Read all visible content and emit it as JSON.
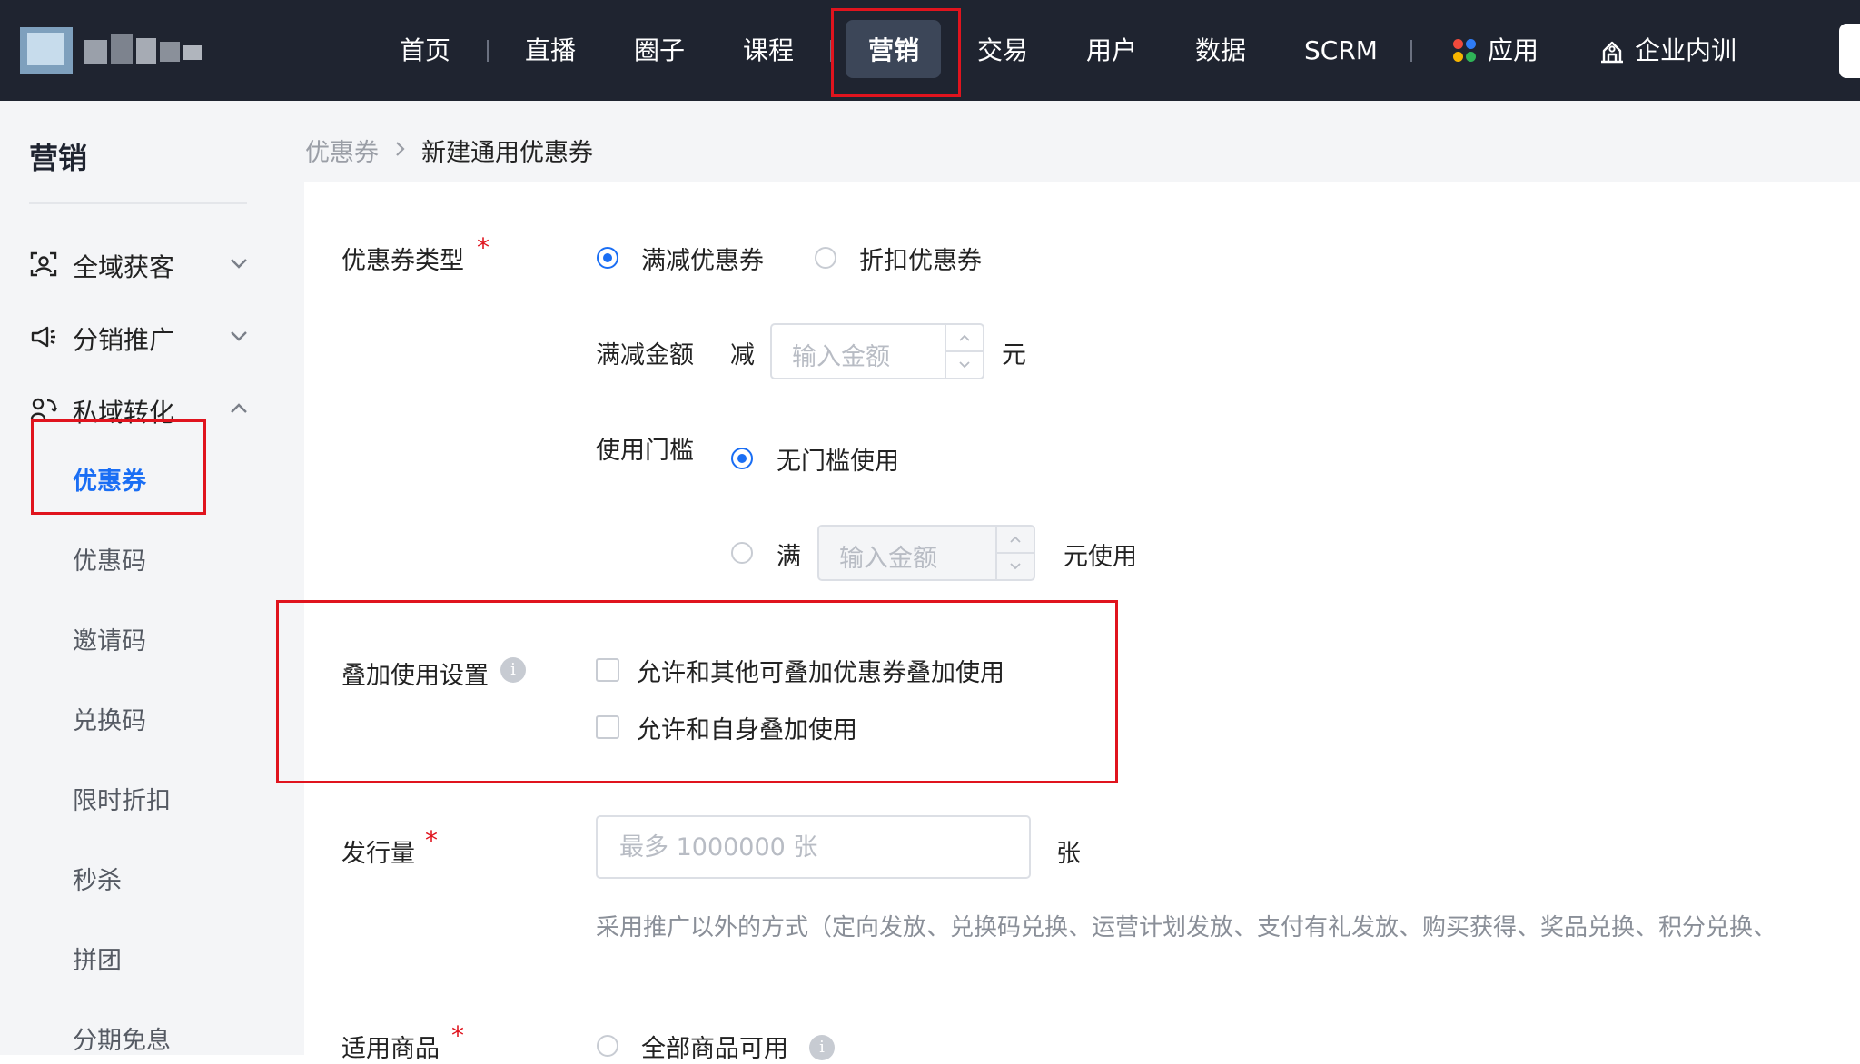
{
  "topnav": {
    "items": [
      {
        "label": "首页"
      },
      {
        "label": "直播"
      },
      {
        "label": "圈子"
      },
      {
        "label": "课程"
      },
      {
        "label": "营销"
      },
      {
        "label": "交易"
      },
      {
        "label": "用户"
      },
      {
        "label": "数据"
      },
      {
        "label": "SCRM"
      },
      {
        "label": "应用"
      },
      {
        "label": "企业内训"
      }
    ],
    "active": "营销"
  },
  "sidebar": {
    "title": "营销",
    "groups": [
      {
        "label": "全域获客",
        "icon": "user-scan-icon",
        "expanded": false
      },
      {
        "label": "分销推广",
        "icon": "megaphone-icon",
        "expanded": false
      },
      {
        "label": "私域转化",
        "icon": "conversion-icon",
        "expanded": true
      }
    ],
    "items": [
      "优惠券",
      "优惠码",
      "邀请码",
      "兑换码",
      "限时折扣",
      "秒杀",
      "拼团",
      "分期免息"
    ],
    "active_item": "优惠券"
  },
  "breadcrumb": {
    "parent": "优惠券",
    "separator": ">",
    "current": "新建通用优惠券"
  },
  "form": {
    "coupon_type": {
      "label": "优惠券类型",
      "required_mark": "*",
      "options": [
        "满减优惠券",
        "折扣优惠券"
      ],
      "selected": "满减优惠券"
    },
    "discount_amount": {
      "label": "满减金额",
      "prefix": "减",
      "placeholder": "输入金额",
      "unit": "元"
    },
    "threshold": {
      "label": "使用门槛",
      "option_none": "无门槛使用",
      "option_min_prefix": "满",
      "placeholder": "输入金额",
      "option_min_suffix": "元使用",
      "selected": "无门槛使用"
    },
    "stacking": {
      "label": "叠加使用设置",
      "info": "i",
      "options": [
        "允许和其他可叠加优惠券叠加使用",
        "允许和自身叠加使用"
      ]
    },
    "issue_qty": {
      "label": "发行量",
      "required_mark": "*",
      "placeholder": "最多 1000000 张",
      "unit": "张",
      "hint": "采用推广以外的方式（定向发放、兑换码兑换、运营计划发放、支付有礼发放、购买获得、奖品兑换、积分兑换、"
    },
    "products": {
      "label": "适用商品",
      "required_mark": "*",
      "option_all": "全部商品可用",
      "info": "i"
    }
  },
  "colors": {
    "topbar": "#1f2430",
    "accent": "#1a6ef4",
    "highlight": "#e0141e",
    "sidebar_bg": "#f4f5f7"
  }
}
